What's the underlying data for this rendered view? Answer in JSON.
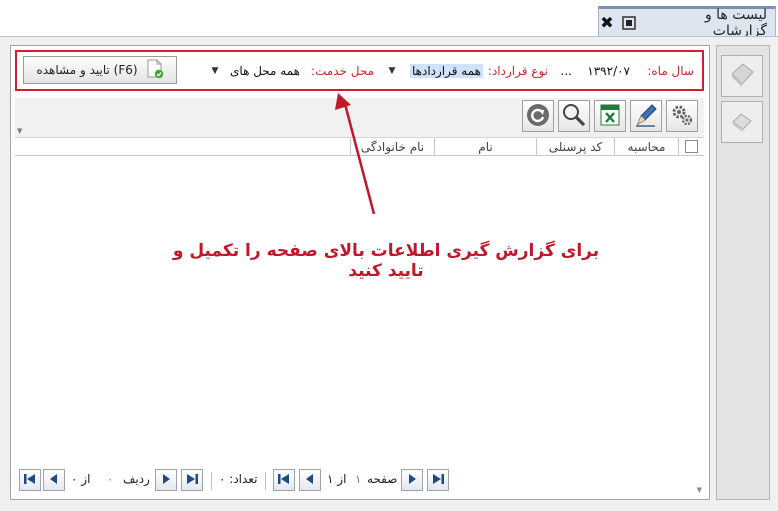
{
  "tab": {
    "title": "لیست ها و گزارشات",
    "icons": [
      "window-restore-icon",
      "close-icon"
    ]
  },
  "filter": {
    "year_month_label": "سال ماه:",
    "year_month_value": "۱۳۹۲/۰۷",
    "year_month_more": "...",
    "contract_type_label": "نوع قرارداد:",
    "contract_type_value": "همه قراردادها",
    "service_place_label": "محل خدمت:",
    "service_place_value": "همه محل های",
    "confirm_button": "تایید و مشاهده (F6)"
  },
  "toolbar": {
    "icons": [
      "settings-icon",
      "edit-icon",
      "excel-export-icon",
      "search-icon",
      "refresh-icon"
    ]
  },
  "grid": {
    "columns": [
      "",
      "محاسبه",
      "کد پرسنلی",
      "نام",
      "نام خانوادگی"
    ],
    "rows": []
  },
  "annotation": "برای گزارش گیری اطلاعات بالای صفحه را تکمیل و تایید کنید",
  "pager": {
    "page_label": "صفحه",
    "page_value": "۱",
    "of_label": "از",
    "page_total": "۱",
    "count_label": "تعداد:",
    "count_value": "۰",
    "row_label": "ردیف",
    "row_value": "۰",
    "row_of_label": "از",
    "row_total": "۰"
  },
  "colors": {
    "highlight_red": "#d0202a",
    "annotation_red": "#c0182a",
    "tab_bg": "#dde6f0"
  }
}
